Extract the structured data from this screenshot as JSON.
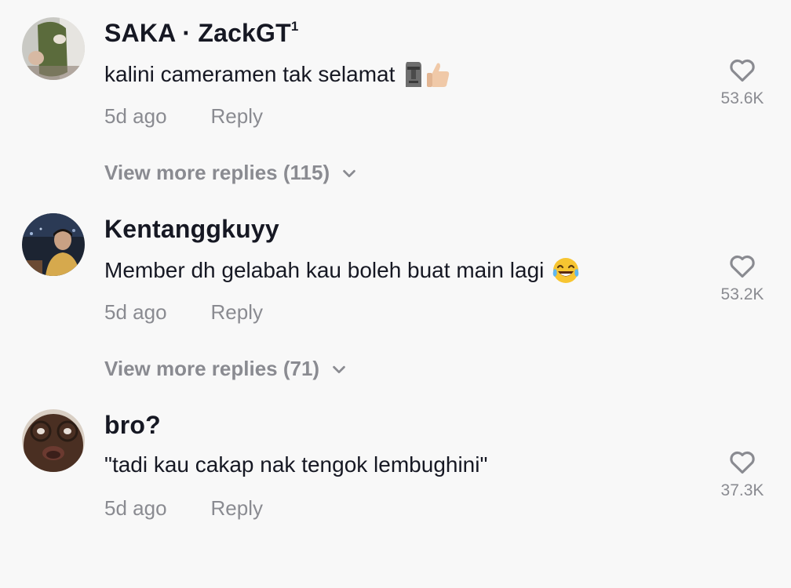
{
  "comments": [
    {
      "username": "SAKA · ZackGT",
      "superscript": "1",
      "text": "kalini cameramen tak selamat",
      "emojis": [
        "moai-emoji",
        "thumbs-up-emoji"
      ],
      "time": "5d ago",
      "reply_label": "Reply",
      "likes": "53.6K",
      "more_replies": "View more replies (115)"
    },
    {
      "username": "Kentanggkuyy",
      "text": "Member dh gelabah kau boleh buat main lagi",
      "emojis": [
        "tears-of-joy-emoji"
      ],
      "time": "5d ago",
      "reply_label": "Reply",
      "likes": "53.2K",
      "more_replies": "View more replies (71)"
    },
    {
      "username": "bro?",
      "text": "\"tadi kau cakap nak tengok lembughini\"",
      "emojis": [],
      "time": "5d ago",
      "reply_label": "Reply",
      "likes": "37.3K"
    }
  ],
  "icons": {
    "like": "heart-icon",
    "expand": "chevron-down-icon"
  },
  "colors": {
    "background": "#f8f8f8",
    "primary_text": "#161823",
    "secondary_text": "#8a8b91"
  }
}
